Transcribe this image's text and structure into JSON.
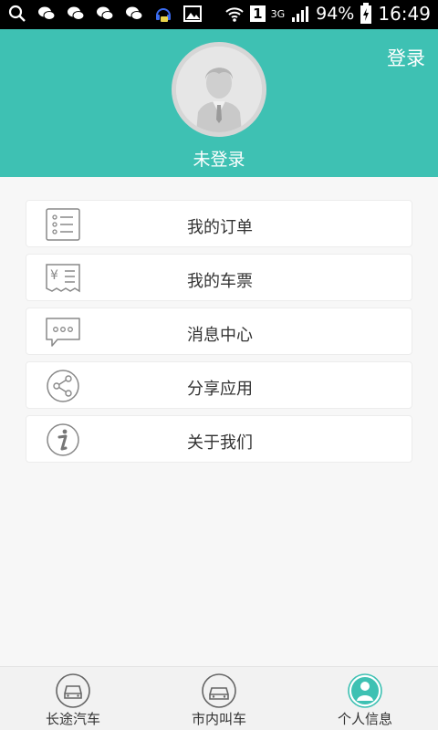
{
  "status_bar": {
    "battery": "94%",
    "network": "3G",
    "sim": "1",
    "time": "16:49"
  },
  "header": {
    "login_label": "登录",
    "username": "未登录",
    "color": "#3ec1b3"
  },
  "menu": {
    "items": [
      {
        "label": "我的订单",
        "icon": "order-list-icon"
      },
      {
        "label": "我的车票",
        "icon": "ticket-icon"
      },
      {
        "label": "消息中心",
        "icon": "message-icon"
      },
      {
        "label": "分享应用",
        "icon": "share-icon"
      },
      {
        "label": "关于我们",
        "icon": "info-icon"
      }
    ]
  },
  "tabs": [
    {
      "label": "长途汽车",
      "icon": "bus-icon",
      "active": false
    },
    {
      "label": "市内叫车",
      "icon": "car-icon",
      "active": false
    },
    {
      "label": "个人信息",
      "icon": "person-icon",
      "active": true
    }
  ]
}
